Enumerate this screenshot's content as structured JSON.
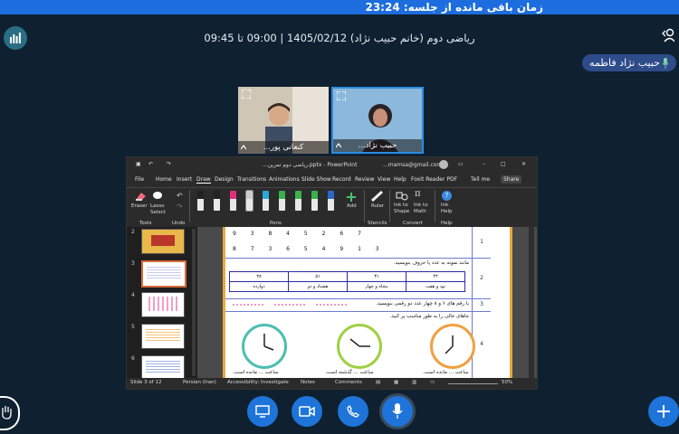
{
  "session": {
    "timer_label": "زمان باقی مانده از جلسه:",
    "timer_value": "23:24",
    "title": "ریاضی دوم (خانم حبیب نژاد) 1405/02/12 | 09:00 تا 09:45"
  },
  "participant_chip": {
    "name": "حبیب نژاد فاطمه"
  },
  "video_tiles": [
    {
      "label": "کنعانی پور..."
    },
    {
      "label": "حبیب نژاد..."
    }
  ],
  "powerpoint": {
    "title": "...ریاضی دوم تمرین.pptx - PowerPoint",
    "account": "...mamsa@gmail.com",
    "tabs": [
      "File",
      "Home",
      "Insert",
      "Draw",
      "Design",
      "Transitions",
      "Animations",
      "Slide Show",
      "Record",
      "Review",
      "View",
      "Help",
      "Foxit Reader PDF",
      "Tell me"
    ],
    "share_label": "Share",
    "ribbon": {
      "eraser": "Eraser",
      "lasso": "Lasso Select",
      "add": "Add",
      "ruler": "Ruler",
      "ink_to_shape": "Ink to Shape",
      "ink_to_math": "Ink to Math",
      "ink_help": "Ink Help",
      "groups": [
        "Tools",
        "Undo",
        "Pens",
        "Stencils",
        "Convert",
        "Help"
      ]
    },
    "pen_colors": [
      "#222222",
      "#222222",
      "#e0307a",
      "#cccccc",
      "#2da8d8",
      "#38b24a",
      "#38b24a",
      "#38b24a",
      "#2a66c8"
    ],
    "thumb_numbers": [
      "2",
      "3",
      "4",
      "5",
      "6"
    ],
    "status": {
      "slide": "Slide 3 of 12",
      "language": "Persian (Iran)",
      "accessibility": "Accessibility: Investigate",
      "notes": "Notes",
      "comments": "Comments",
      "zoom": "50%"
    },
    "worksheet": {
      "row1_top_digits": "9 3 8 4 5 2 6 7",
      "row1_bottom_digits": "8 7 3 6 5 4 9 1 3",
      "row2_instruction": "مانند نمونه به عدد یا حروف بنویسید.",
      "row2_cells": [
        "۳۸",
        "۵۱",
        "۳۱",
        "۴۳"
      ],
      "row2_words": [
        "دوازده",
        "هشتاد و دو",
        "پنجاه و چهار",
        "نود و هفت"
      ],
      "row3_instruction": "با رقم های ۶ و ۸ چهار عدد دو رقمی بنویسید.",
      "row4_instruction": "جاهای خالی را به طور مناسب پر کنید.",
      "clock_captions": [
        "ساعت ... مانده است.",
        "ساعت ... گذشته است.",
        "ساعت ... مانده است."
      ],
      "row_numbers": [
        "1",
        "2",
        "3",
        "4"
      ]
    }
  },
  "controls": [
    "screen-share",
    "camera",
    "phone",
    "microphone"
  ],
  "colors": {
    "accent": "#1e74d8",
    "background": "#0f2030",
    "topbar": "#1d6dde"
  }
}
